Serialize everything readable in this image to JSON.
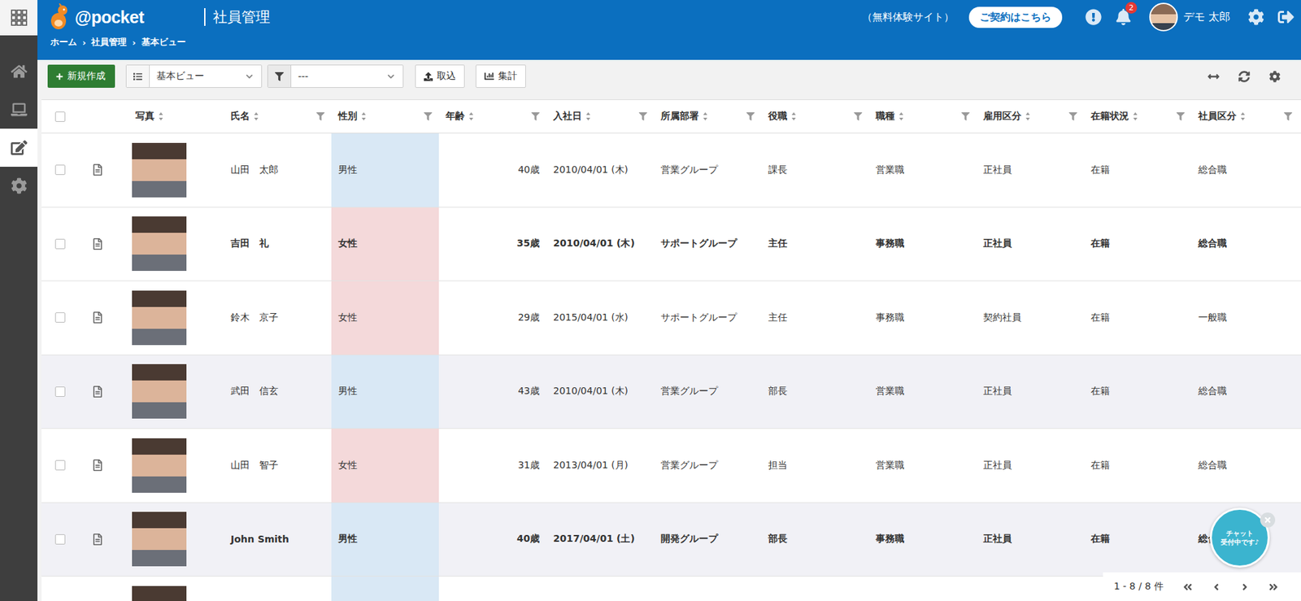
{
  "app": {
    "logo": "@pocket"
  },
  "header": {
    "title": "社員管理",
    "trial": "（無料体験サイト）",
    "contract_button": "ご契約はこちら",
    "notifications": "2",
    "user": "デモ 太郎"
  },
  "breadcrumb": {
    "items": [
      "ホーム",
      "社員管理",
      "基本ビュー"
    ],
    "separator": "›"
  },
  "sidebar": {
    "items": [
      {
        "kind": "home",
        "selected": false
      },
      {
        "kind": "screen",
        "selected": false
      },
      {
        "kind": "edit",
        "selected": true
      },
      {
        "kind": "settings",
        "selected": false
      }
    ]
  },
  "toolbar": {
    "new_button": "新規作成",
    "view": "基本ビュー",
    "filter": "---",
    "import": "取込",
    "summary": "集計"
  },
  "table": {
    "select_all": false,
    "columns": [
      {
        "label": "",
        "kind": "checkbox"
      },
      {
        "label": "",
        "kind": "icon"
      },
      {
        "label": "写真",
        "kind": "photo"
      },
      {
        "label": "氏名",
        "kind": "text"
      },
      {
        "label": "性別",
        "kind": "gender"
      },
      {
        "label": "年齢",
        "kind": "number"
      },
      {
        "label": "入社日",
        "kind": "text"
      },
      {
        "label": "所属部署",
        "kind": "text"
      },
      {
        "label": "役職",
        "kind": "text"
      },
      {
        "label": "職種",
        "kind": "text"
      },
      {
        "label": "雇用区分",
        "kind": "text"
      },
      {
        "label": "在籍状況",
        "kind": "text"
      },
      {
        "label": "社員区分",
        "kind": "text"
      }
    ],
    "rows": [
      {
        "checked": false,
        "bold": false,
        "highlighted": false,
        "color": "#d9e8f5",
        "cells": [
          "山田　太郎",
          "男性",
          "40歳",
          "2010/04/01 (木)",
          "営業グループ",
          "課長",
          "営業職",
          "正社員",
          "在籍",
          "総合職"
        ]
      },
      {
        "checked": false,
        "bold": true,
        "highlighted": false,
        "color": "#f4d9da",
        "cells": [
          "吉田　礼",
          "女性",
          "35歳",
          "2010/04/01 (木)",
          "サポートグループ",
          "主任",
          "事務職",
          "正社員",
          "在籍",
          "総合職"
        ]
      },
      {
        "checked": false,
        "bold": false,
        "highlighted": false,
        "color": "#f4d9da",
        "cells": [
          "鈴木　京子",
          "女性",
          "29歳",
          "2015/04/01 (水)",
          "サポートグループ",
          "主任",
          "事務職",
          "契約社員",
          "在籍",
          "一般職"
        ]
      },
      {
        "checked": false,
        "bold": false,
        "highlighted": true,
        "color": "#d9e8f5",
        "cells": [
          "武田　信玄",
          "男性",
          "43歳",
          "2010/04/01 (木)",
          "営業グループ",
          "部長",
          "営業職",
          "正社員",
          "在籍",
          "総合職"
        ]
      },
      {
        "checked": false,
        "bold": false,
        "highlighted": false,
        "color": "#f4d9da",
        "cells": [
          "山田　智子",
          "女性",
          "31歳",
          "2013/04/01 (月)",
          "営業グループ",
          "担当",
          "営業職",
          "正社員",
          "在籍",
          "総合職"
        ]
      },
      {
        "checked": false,
        "bold": true,
        "highlighted": true,
        "color": "#d9e8f5",
        "cells": [
          "John Smith",
          "男性",
          "40歳",
          "2017/04/01 (土)",
          "開発グループ",
          "部長",
          "事務職",
          "正社員",
          "在籍",
          "総合職"
        ]
      },
      {
        "checked": false,
        "bold": false,
        "highlighted": false,
        "color": "#d9e8f5",
        "cells": [
          "",
          "",
          "",
          "",
          "",
          "",
          "",
          "",
          "",
          ""
        ]
      }
    ]
  },
  "pagination": {
    "range": "1 - 8 / 8 件"
  },
  "chat": {
    "lines": [
      "チャット",
      "受付中です♪"
    ]
  }
}
